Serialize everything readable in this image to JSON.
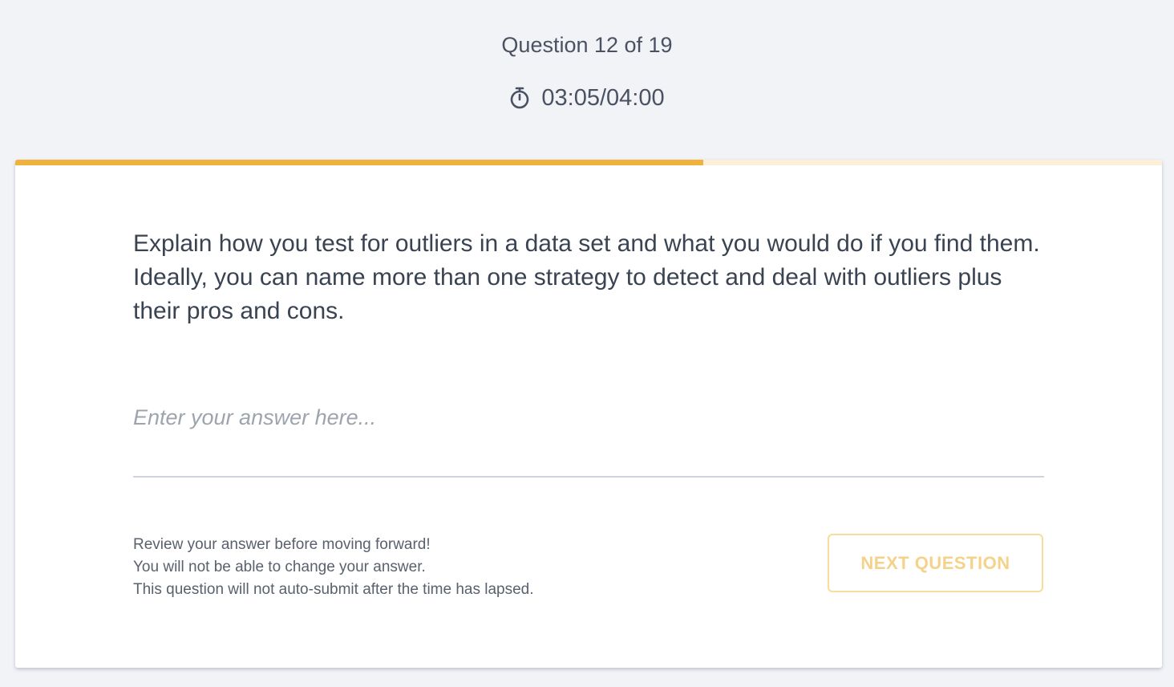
{
  "header": {
    "counter": "Question 12 of 19",
    "timer": "03:05/04:00",
    "timer_icon": "stopwatch-icon"
  },
  "progress": {
    "fraction": 0.6,
    "fill_color": "#f0b23c",
    "track_color": "#fdf0d9"
  },
  "question": {
    "text": "Explain how you test for outliers in a data set and what you would do if you find them. Ideally, you can name more than one strategy to detect and deal with outliers plus their pros and cons."
  },
  "answer": {
    "value": "",
    "placeholder": "Enter your answer here..."
  },
  "notice": {
    "line1": "Review your answer before moving forward!",
    "line2": "You will not be able to change your answer.",
    "line3": "This question will not auto-submit after the time has lapsed."
  },
  "actions": {
    "next_label": "NEXT QUESTION",
    "next_color": "#f5d28a"
  }
}
